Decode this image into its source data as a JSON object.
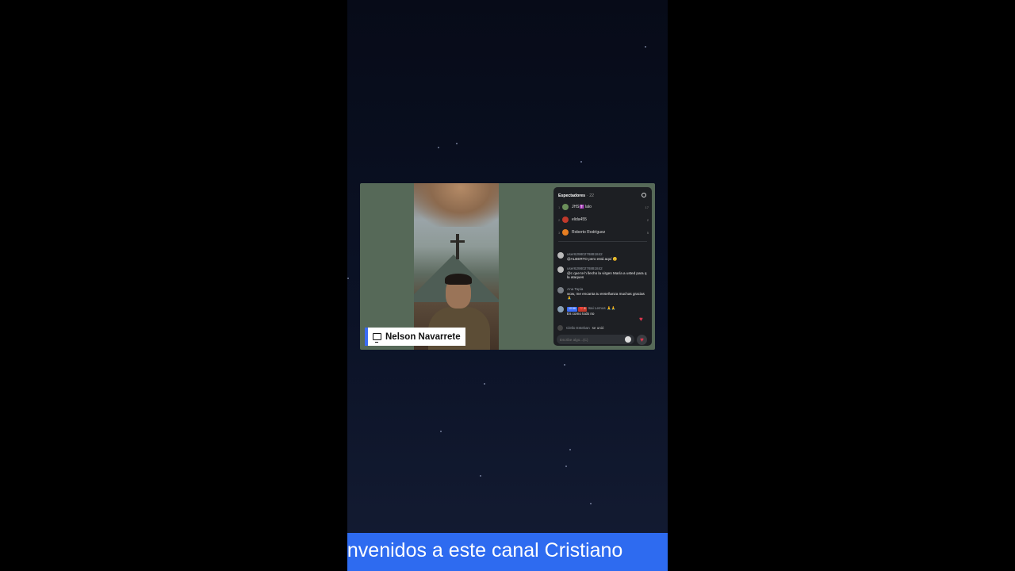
{
  "stream": {
    "presenter_name": "Nelson Navarrete"
  },
  "viewers_panel": {
    "title": "Espectadores",
    "count": "· 22",
    "top_viewers": [
      {
        "rank": "1",
        "name": "JHS✝️ lalo",
        "score": "17",
        "avatar_color": "#6b8f5a"
      },
      {
        "rank": "2",
        "name": "elida455",
        "score": "2",
        "avatar_color": "#c0392b"
      },
      {
        "rank": "3",
        "name": "Roberto Rodríguez",
        "score": "5",
        "avatar_color": "#e67e22"
      }
    ]
  },
  "chat": {
    "messages": [
      {
        "user": "user6298027688184​2",
        "text": "@ALBERTO pero está aquí 😊"
      },
      {
        "user": "user6298027688184​2",
        "text": "@c que te h llecho la virgen María a usted para q la ataques"
      },
      {
        "user": "Ana Tapia",
        "text": "wow, me encanta tu enseñanza muchas gracias 🙏"
      },
      {
        "user": "Isai Lemus 🙏🙏",
        "badge1": "10 66",
        "badge2": "❤️ 8",
        "text": "Es como todo no"
      }
    ],
    "joined_user": "Clelio Esteban",
    "joined_text": "se unió",
    "input_placeholder": "Escribe algo...(C)"
  },
  "ticker": {
    "text": "envenidos a este canal Cristiano"
  },
  "colors": {
    "ticker_bg": "#2e6bf0",
    "stream_bg": "#566958",
    "name_tag_accent": "#3b6cf6",
    "heart": "#e0384f"
  },
  "icons": [
    "monitor-icon",
    "settings-icon",
    "emoji-icon",
    "heart-icon"
  ]
}
